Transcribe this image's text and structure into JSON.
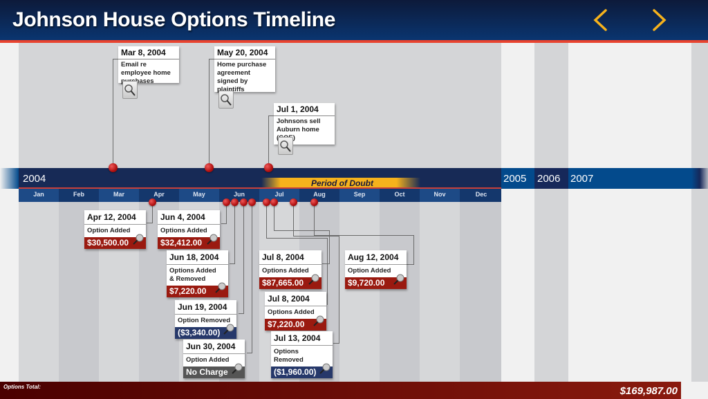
{
  "header": {
    "title": "Johnson House Options Timeline"
  },
  "nav": {
    "back_label": "Previous",
    "forward_label": "Next"
  },
  "timeline": {
    "current_year": "2004",
    "future_years": [
      "2005",
      "2006",
      "2007"
    ],
    "months": [
      "Jan",
      "Feb",
      "Mar",
      "Apr",
      "May",
      "Jun",
      "Jul",
      "Aug",
      "Sep",
      "Oct",
      "Nov",
      "Dec"
    ],
    "highlight_label": "Period of Doubt"
  },
  "events": [
    {
      "date": "Mar 8, 2004",
      "description": "Email re employee home purchases",
      "icon": "document-search-icon"
    },
    {
      "date": "May 20, 2004",
      "description": "Home purchase agreement signed by plaintiffs",
      "icon": "document-search-icon"
    },
    {
      "date": "Jul 1, 2004",
      "description": "Johnsons sell Auburn home (COE)",
      "icon": "document-search-icon"
    }
  ],
  "options": [
    {
      "date": "Apr 12, 2004",
      "description": "Option Added",
      "amount": "$30,500.00",
      "type": "added"
    },
    {
      "date": "Jun 4, 2004",
      "description": "Options Added",
      "amount": "$32,412.00",
      "type": "added"
    },
    {
      "date": "Jun 18, 2004",
      "description": "Options Added & Removed",
      "amount": "$7,220.00",
      "type": "added"
    },
    {
      "date": "Jun 19, 2004",
      "description": "Option Removed",
      "amount": "($3,340.00)",
      "type": "removed"
    },
    {
      "date": "Jun 30, 2004",
      "description": "Option Added",
      "amount": "No Charge",
      "type": "none"
    },
    {
      "date": "Jul 8, 2004",
      "description": "Options Added",
      "amount": "$87,665.00",
      "type": "added"
    },
    {
      "date": "Jul 8, 2004",
      "description": "Options Added",
      "amount": "$7,220.00",
      "type": "added"
    },
    {
      "date": "Jul 13, 2004",
      "description": "Options Removed",
      "amount": "($1,960.00)",
      "type": "removed"
    },
    {
      "date": "Aug 12, 2004",
      "description": "Option Added",
      "amount": "$9,720.00",
      "type": "added"
    }
  ],
  "footer": {
    "label": "Options Total:",
    "total": "$169,987.00"
  },
  "colors": {
    "added": "#9a1a10",
    "removed": "#26386a",
    "none": "#555555",
    "accent": "#f6b21c",
    "header_rule": "#e8432f"
  }
}
